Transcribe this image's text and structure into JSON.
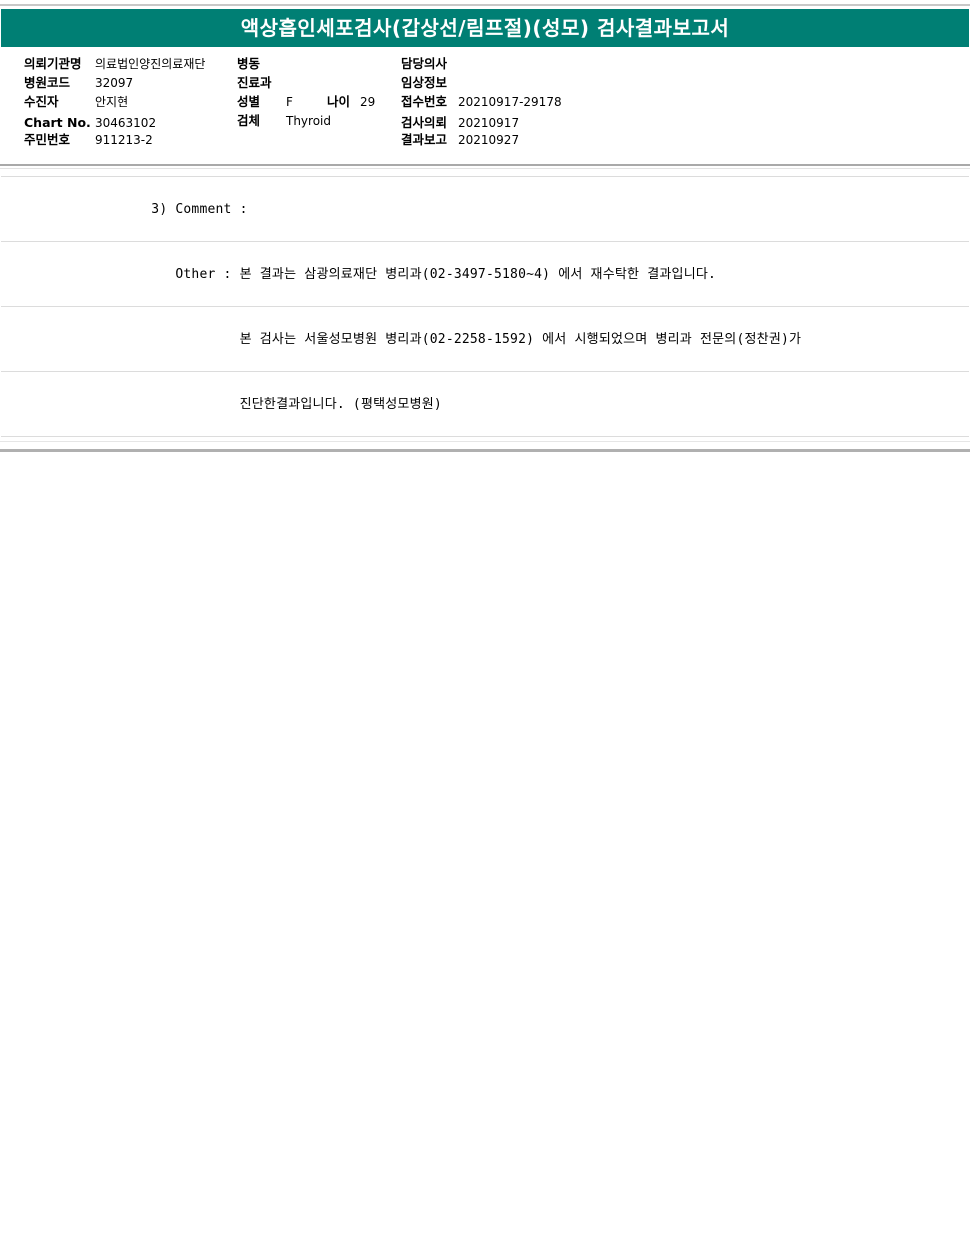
{
  "report": {
    "title": "액상흡인세포검사(갑상선/림프절)(성모) 검사결과보고서"
  },
  "patient_info": {
    "institution_label": "의뢰기관명",
    "institution_value": "의료법인양진의료재단",
    "hospital_code_label": "병원코드",
    "hospital_code_value": "32097",
    "recipient_label": "수진자",
    "recipient_value": "안지현",
    "chart_no_label": "Chart No.",
    "chart_no_value": "30463102",
    "resident_no_label": "주민번호",
    "resident_no_value": "911213-2",
    "ward_label": "병동",
    "ward_value": "",
    "department_label": "진료과",
    "department_value": "",
    "sex_label": "성별",
    "sex_value": "F",
    "age_label": "나이",
    "age_value": "29",
    "specimen_label": "검체",
    "specimen_value": "Thyroid",
    "doctor_label": "담당의사",
    "doctor_value": "",
    "clinical_info_label": "임상정보",
    "clinical_info_value": "",
    "receipt_no_label": "접수번호",
    "receipt_no_value": "20210917-29178",
    "request_date_label": "검사의뢰",
    "request_date_value": "20210917",
    "report_date_label": "결과보고",
    "report_date_value": "20210927"
  },
  "comments": {
    "line1": "           3) Comment :",
    "line2": "              Other : 본 결과는 삼광의료재단 병리과(02-3497-5180~4) 에서 재수탁한 결과입니다.",
    "line3": "                      본 검사는 서울성모병원 병리과(02-2258-1592) 에서 시행되었으며 병리과 전문의(정찬권)가",
    "line4": "                      진단한결과입니다. (평택성모병원)"
  }
}
